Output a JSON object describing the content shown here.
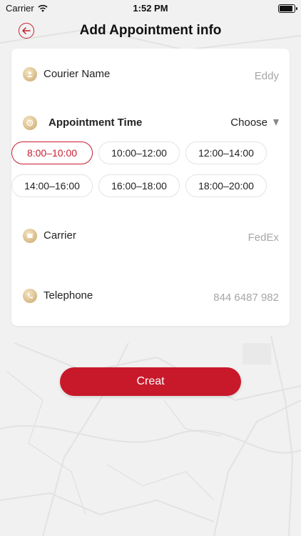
{
  "status_bar": {
    "carrier": "Carrier",
    "time": "1:52 PM",
    "battery_level": 100
  },
  "header": {
    "title": "Add Appointment info"
  },
  "form": {
    "courier": {
      "label": "Courier Name",
      "value": "Eddy"
    },
    "appointment": {
      "label": "Appointment Time",
      "choose_label": "Choose",
      "slots": [
        {
          "label": "8:00–10:00",
          "selected": true
        },
        {
          "label": "10:00–12:00",
          "selected": false
        },
        {
          "label": "12:00–14:00",
          "selected": false
        },
        {
          "label": "14:00–16:00",
          "selected": false
        },
        {
          "label": "16:00–18:00",
          "selected": false
        },
        {
          "label": "18:00–20:00",
          "selected": false
        }
      ]
    },
    "carrier": {
      "label": "Carrier",
      "value": "FedEx"
    },
    "telephone": {
      "label": "Telephone",
      "value": "844 6487 982"
    }
  },
  "actions": {
    "creat_label": "Creat"
  },
  "colors": {
    "accent": "#c8192b",
    "value_gray": "#a6a6a6",
    "icon_gold": "#c9a56b"
  },
  "icons": {
    "back": "arrow-left-circle-icon",
    "courier": "person-badge-icon",
    "appointment": "clock-badge-icon",
    "carrier": "box-badge-icon",
    "telephone": "phone-badge-icon",
    "dropdown": "triangle-down-icon",
    "wifi": "wifi-icon",
    "battery": "battery-icon"
  }
}
